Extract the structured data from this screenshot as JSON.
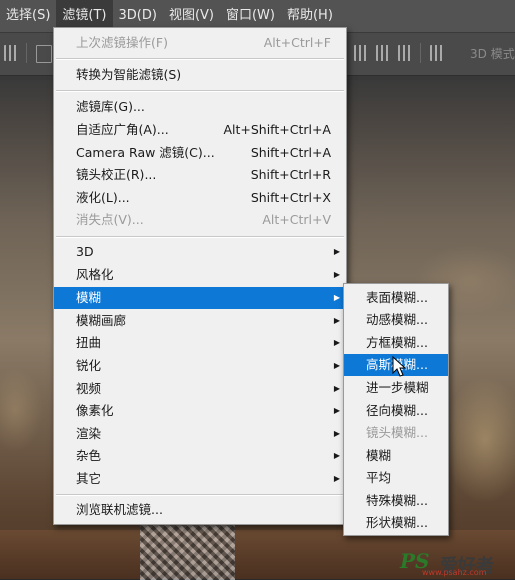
{
  "menubar": {
    "items": [
      "选择(S)",
      "滤镜(T)",
      "3D(D)",
      "视图(V)",
      "窗口(W)",
      "帮助(H)"
    ],
    "active_index": 1
  },
  "optionsbar": {
    "mode_label": "3D 模式"
  },
  "filter_menu": {
    "items": [
      {
        "label": "上次滤镜操作(F)",
        "shortcut": "Alt+Ctrl+F",
        "disabled": true
      },
      {
        "label": "转换为智能滤镜(S)",
        "shortcut": "",
        "disabled": false
      },
      {
        "label": "滤镜库(G)...",
        "shortcut": "",
        "disabled": false
      },
      {
        "label": "自适应广角(A)...",
        "shortcut": "Alt+Shift+Ctrl+A",
        "disabled": false
      },
      {
        "label": "Camera Raw 滤镜(C)...",
        "shortcut": "Shift+Ctrl+A",
        "disabled": false
      },
      {
        "label": "镜头校正(R)...",
        "shortcut": "Shift+Ctrl+R",
        "disabled": false
      },
      {
        "label": "液化(L)...",
        "shortcut": "Shift+Ctrl+X",
        "disabled": false
      },
      {
        "label": "消失点(V)...",
        "shortcut": "Alt+Ctrl+V",
        "disabled": true
      },
      {
        "label": "3D",
        "submenu": true
      },
      {
        "label": "风格化",
        "submenu": true
      },
      {
        "label": "模糊",
        "submenu": true,
        "highlighted": true
      },
      {
        "label": "模糊画廊",
        "submenu": true
      },
      {
        "label": "扭曲",
        "submenu": true
      },
      {
        "label": "锐化",
        "submenu": true
      },
      {
        "label": "视频",
        "submenu": true
      },
      {
        "label": "像素化",
        "submenu": true
      },
      {
        "label": "渲染",
        "submenu": true
      },
      {
        "label": "杂色",
        "submenu": true
      },
      {
        "label": "其它",
        "submenu": true
      },
      {
        "label": "浏览联机滤镜...",
        "shortcut": ""
      }
    ]
  },
  "blur_menu": {
    "items": [
      {
        "label": "表面模糊...",
        "disabled": false
      },
      {
        "label": "动感模糊...",
        "disabled": false
      },
      {
        "label": "方框模糊...",
        "disabled": false
      },
      {
        "label": "高斯模糊...",
        "disabled": false,
        "highlighted": true
      },
      {
        "label": "进一步模糊",
        "disabled": false
      },
      {
        "label": "径向模糊...",
        "disabled": false
      },
      {
        "label": "镜头模糊...",
        "disabled": true
      },
      {
        "label": "模糊",
        "disabled": false
      },
      {
        "label": "平均",
        "disabled": false
      },
      {
        "label": "特殊模糊...",
        "disabled": false
      },
      {
        "label": "形状模糊...",
        "disabled": false
      }
    ]
  },
  "watermark": {
    "brand": "PS",
    "cn": "爱好者",
    "url": "www.psahz.com"
  },
  "colors": {
    "highlight": "#0d78d6",
    "menu_bg": "#f0f0f0",
    "menubar_bg": "#535353"
  }
}
